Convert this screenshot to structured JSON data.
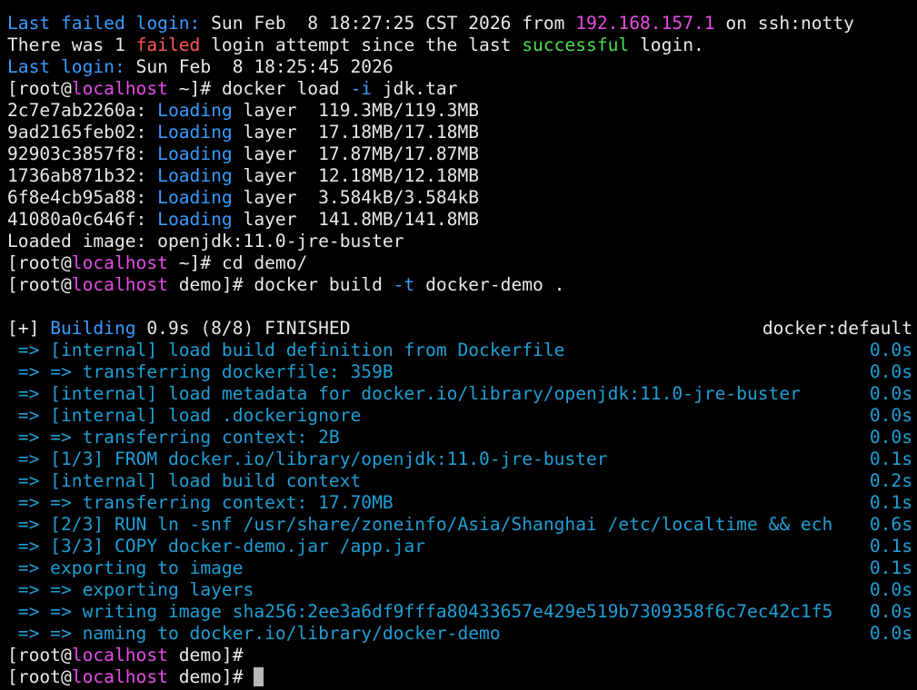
{
  "colors": {
    "background": "#000000",
    "text": "#e8e8e8",
    "label_blue": "#3a9bff",
    "host_magenta": "#e64ce6",
    "failed_red": "#ff5555",
    "success_green": "#4ade4a",
    "build_step_blue": "#1f9fd6",
    "cursor": "#b8b8b8"
  },
  "login": {
    "failed_label": "Last failed login:",
    "failed_time": " Sun Feb  8 18:27:25 CST 2026 from ",
    "failed_ip": "192.168.157.1",
    "failed_suffix": " on ssh:notty",
    "attempt_pre": "There was 1 ",
    "attempt_failed": "failed",
    "attempt_mid": " login attempt since the last ",
    "attempt_success": "successful",
    "attempt_post": " login.",
    "last_label": "Last login:",
    "last_time": " Sun Feb  8 18:25:45 2026"
  },
  "prompt": {
    "open": "[root@",
    "host": "localhost",
    "dir_home": " ~]# ",
    "dir_demo": " demo]# ",
    "dir_demo_bare": " demo]#"
  },
  "cmd_load": {
    "pre": "docker load ",
    "flag": "-i",
    "post": " jdk.tar"
  },
  "layers": [
    {
      "id": "2c7e7ab2260a:",
      "status": "Loading",
      "word": " layer  ",
      "size": "119.3MB/119.3MB"
    },
    {
      "id": "9ad2165feb02:",
      "status": "Loading",
      "word": " layer  ",
      "size": "17.18MB/17.18MB"
    },
    {
      "id": "92903c3857f8:",
      "status": "Loading",
      "word": " layer  ",
      "size": "17.87MB/17.87MB"
    },
    {
      "id": "1736ab871b32:",
      "status": "Loading",
      "word": " layer  ",
      "size": "12.18MB/12.18MB"
    },
    {
      "id": "6f8e4cb95a88:",
      "status": "Loading",
      "word": " layer  ",
      "size": "3.584kB/3.584kB"
    },
    {
      "id": "41080a0c646f:",
      "status": "Loading",
      "word": " layer  ",
      "size": "141.8MB/141.8MB"
    }
  ],
  "loaded_image": "Loaded image: openjdk:11.0-jre-buster",
  "cmd_cd": "cd demo/",
  "cmd_build": {
    "pre": "docker build ",
    "flag": "-t",
    "post": " docker-demo ."
  },
  "build_header": {
    "bracket": "[+] ",
    "building": "Building",
    "status": " 0.9s (8/8) FINISHED",
    "context": "docker:default"
  },
  "build_steps": [
    {
      "text": " => [internal] load build definition from Dockerfile",
      "time": "0.0s"
    },
    {
      "text": " => => transferring dockerfile: 359B",
      "time": "0.0s"
    },
    {
      "text": " => [internal] load metadata for docker.io/library/openjdk:11.0-jre-buster",
      "time": "0.0s"
    },
    {
      "text": " => [internal] load .dockerignore",
      "time": "0.0s"
    },
    {
      "text": " => => transferring context: 2B",
      "time": "0.0s"
    },
    {
      "text": " => [1/3] FROM docker.io/library/openjdk:11.0-jre-buster",
      "time": "0.1s"
    },
    {
      "text": " => [internal] load build context",
      "time": "0.2s"
    },
    {
      "text": " => => transferring context: 17.70MB",
      "time": "0.1s"
    },
    {
      "text": " => [2/3] RUN ln -snf /usr/share/zoneinfo/Asia/Shanghai /etc/localtime && ech",
      "time": "0.6s"
    },
    {
      "text": " => [3/3] COPY docker-demo.jar /app.jar",
      "time": "0.1s"
    },
    {
      "text": " => exporting to image",
      "time": "0.1s"
    },
    {
      "text": " => => exporting layers",
      "time": "0.0s"
    },
    {
      "text": " => => writing image sha256:2ee3a6df9fffa80433657e429e519b7309358f6c7ec42c1f5",
      "time": "0.0s"
    },
    {
      "text": " => => naming to docker.io/library/docker-demo",
      "time": "0.0s"
    }
  ]
}
